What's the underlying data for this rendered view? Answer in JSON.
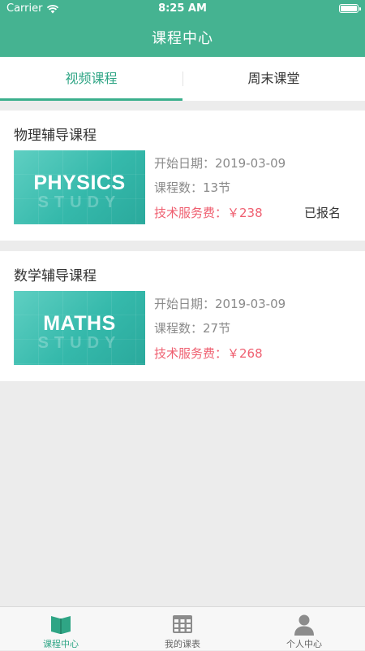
{
  "status_bar": {
    "carrier": "Carrier",
    "time": "8:25 AM",
    "battery_level": 100
  },
  "nav": {
    "title": "课程中心"
  },
  "tabs": [
    {
      "label": "视频课程",
      "active": true
    },
    {
      "label": "周末课堂",
      "active": false
    }
  ],
  "courses": [
    {
      "title": "物理辅导课程",
      "thumb_text": "PHYSICS",
      "thumb_sub": "STUDY",
      "start_date": "开始日期：2019-03-09",
      "lesson_count": "课程数：13节",
      "fee": "技术服务费：￥238",
      "enrolled": "已报名"
    },
    {
      "title": "数学辅导课程",
      "thumb_text": "MATHS",
      "thumb_sub": "STUDY",
      "start_date": "开始日期：2019-03-09",
      "lesson_count": "课程数：27节",
      "fee": "技术服务费：￥268",
      "enrolled": ""
    }
  ],
  "tabbar": [
    {
      "label": "课程中心",
      "icon": "book-icon",
      "active": true
    },
    {
      "label": "我的课表",
      "icon": "timetable-icon",
      "active": false
    },
    {
      "label": "个人中心",
      "icon": "person-icon",
      "active": false
    }
  ],
  "colors": {
    "brand": "#45b391",
    "tab_active": "#2fa585",
    "price": "#ef5f70"
  }
}
